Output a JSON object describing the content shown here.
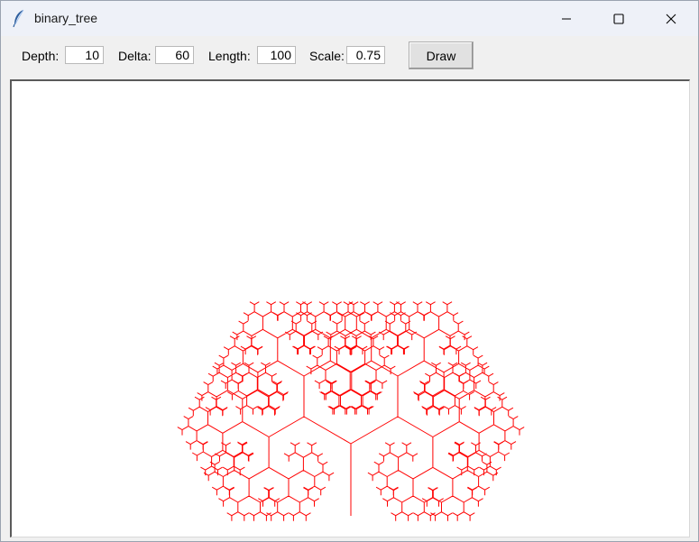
{
  "window": {
    "title": "binary_tree",
    "icon": "feather-icon",
    "controls": [
      "minimize-icon",
      "maximize-icon",
      "close-icon"
    ]
  },
  "toolbar": {
    "depth_label": "Depth:",
    "depth_value": "10",
    "delta_label": "Delta:",
    "delta_value": "60",
    "length_label": "Length:",
    "length_value": "100",
    "scale_label": "Scale:",
    "scale_value": "0.75",
    "draw_label": "Draw"
  },
  "canvas": {
    "background": "#ffffff",
    "line_color": "#ff0000",
    "tree": {
      "depth": 10,
      "delta_degrees": 60,
      "length": 100,
      "scale": 0.75
    }
  }
}
